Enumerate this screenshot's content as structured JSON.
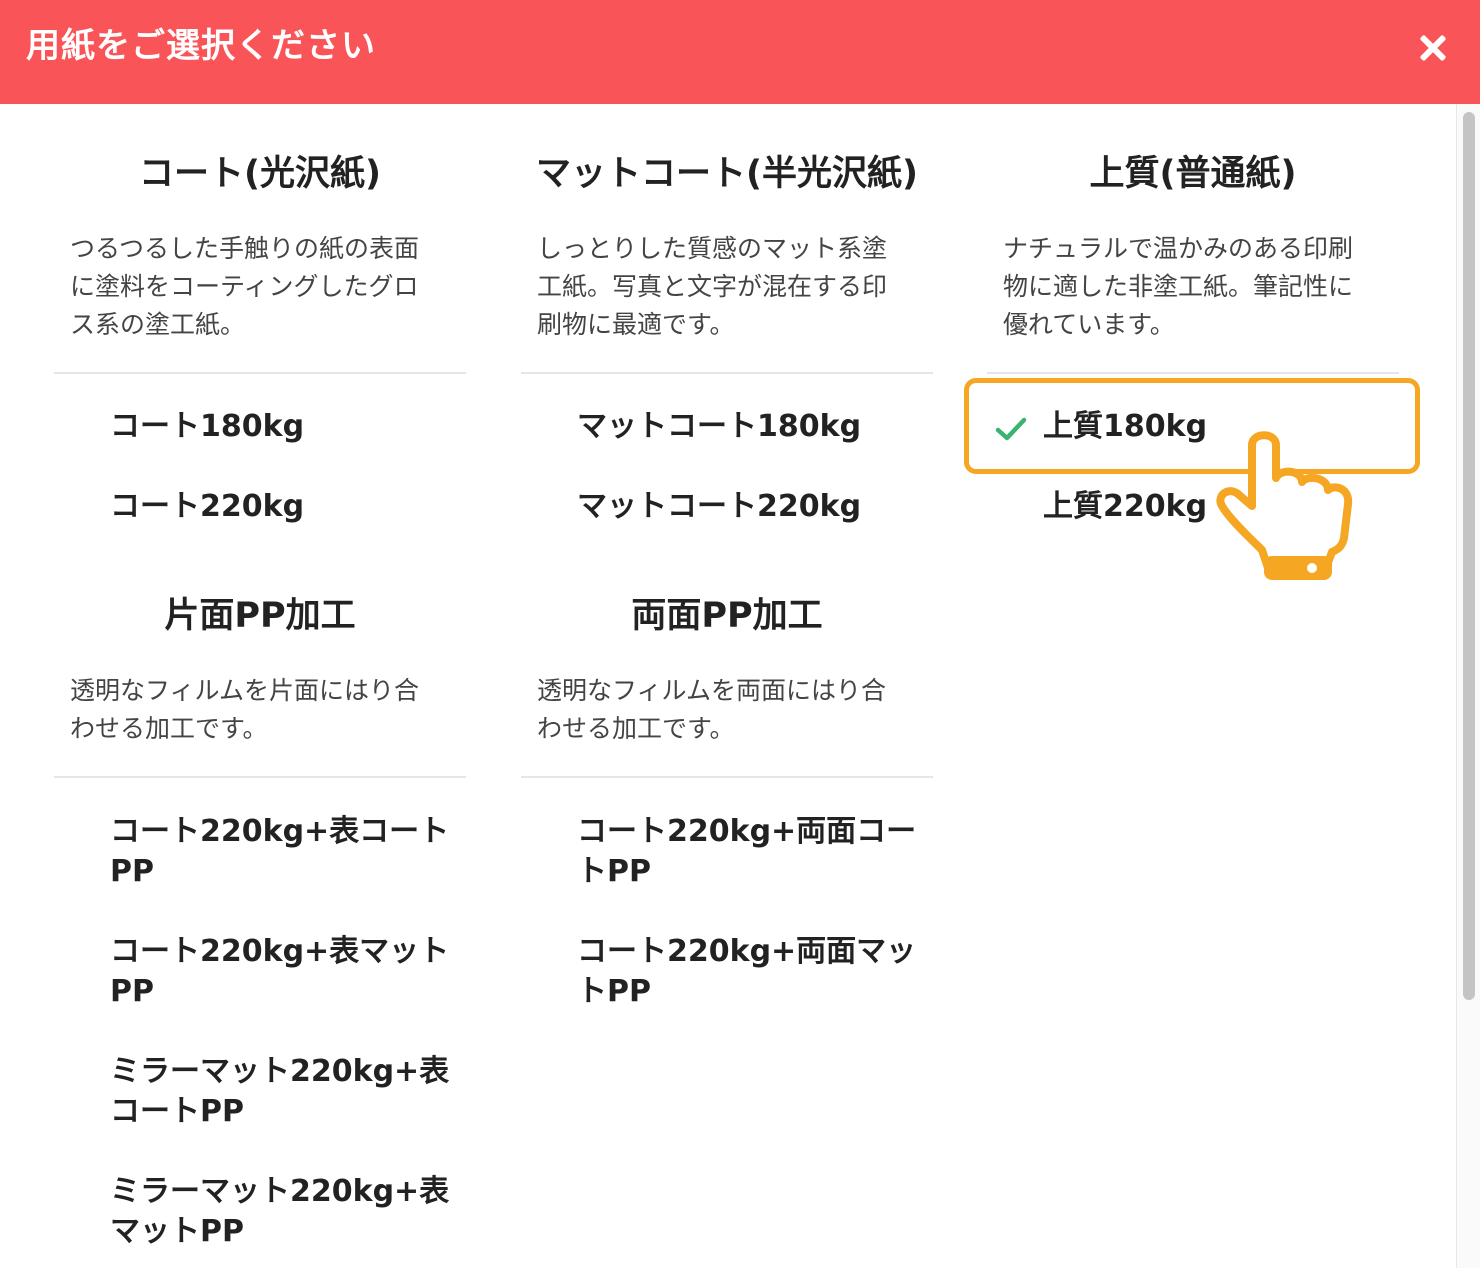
{
  "header": {
    "title": "用紙をご選択ください",
    "close_icon": "close-icon",
    "background": "#f95458"
  },
  "groups": [
    {
      "title": "コート(光沢紙)",
      "desc_lines": [
        "つるつるした手触りの紙の表面",
        "に塗料をコーティングしたグロ",
        "ス系の塗工紙。"
      ],
      "options": [
        "コート180kg",
        "コート220kg"
      ]
    },
    {
      "title": "マットコート(半光沢紙)",
      "desc_lines": [
        "しっとりした質感のマット系塗",
        "工紙。写真と文字が混在する印",
        "刷物に最適です。"
      ],
      "options": [
        "マットコート180kg",
        "マットコート220kg"
      ]
    },
    {
      "title": "上質(普通紙)",
      "desc_lines": [
        "ナチュラルで温かみのある印刷",
        "物に適した非塗工紙。筆記性に",
        "優れています。"
      ],
      "options": [
        "上質180kg",
        "上質220kg"
      ],
      "selected": "上質180kg"
    },
    {
      "title": "片面PP加工",
      "desc_lines": [
        "透明なフィルムを片面にはり合",
        "わせる加工です。"
      ],
      "options": [
        [
          "コート220kg+表コート",
          "PP"
        ],
        [
          "コート220kg+表マット",
          "PP"
        ],
        [
          "ミラーマット220kg+表",
          "コートPP"
        ],
        [
          "ミラーマット220kg+表",
          "マットPP"
        ]
      ]
    },
    {
      "title": "両面PP加工",
      "desc_lines": [
        "透明なフィルムを両面にはり合",
        "わせる加工です。"
      ],
      "options": [
        [
          "コート220kg+両面コー",
          "トPP"
        ],
        [
          "コート220kg+両面マッ",
          "トPP"
        ]
      ]
    }
  ],
  "icons": {
    "selected_check": "check-icon",
    "pointer": "hand-pointer-icon"
  },
  "colors": {
    "highlight": "#f5a623",
    "check": "#3cb371"
  }
}
